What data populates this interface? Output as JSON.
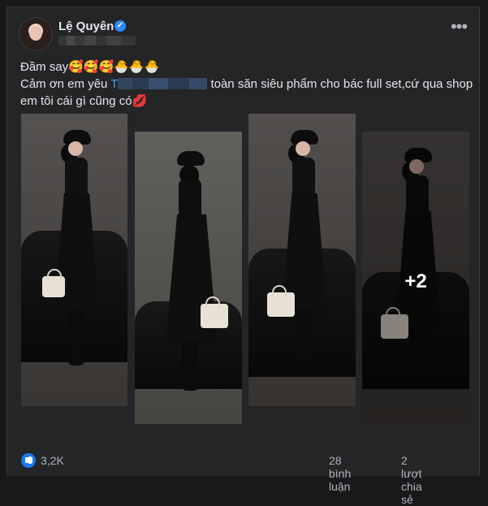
{
  "post": {
    "author": "Lệ Quyên",
    "line1": "Đầm say🥰🥰🥰🐣🐣🐣",
    "line2_prefix": "Cảm ơn em yêu ",
    "mention_visible": "T",
    "line2_suffix": "toàn săn siêu phẩm cho bác full set,cứ qua shop",
    "line3": "em tôi cái gì cũng có💋",
    "extra_photos": "+2"
  },
  "footer": {
    "reactions": "3,2K",
    "comments": "28 bình luận",
    "shares": "2 lượt chia sẻ"
  },
  "icons": {
    "more": "more-options-icon",
    "verified": "verified-badge-icon",
    "like": "like-reaction-icon"
  },
  "colors": {
    "background": "#18191a",
    "card": "#242526",
    "text": "#e4e6eb",
    "muted": "#b0b3b8",
    "link": "#4e9cff",
    "accent": "#1877f2"
  }
}
